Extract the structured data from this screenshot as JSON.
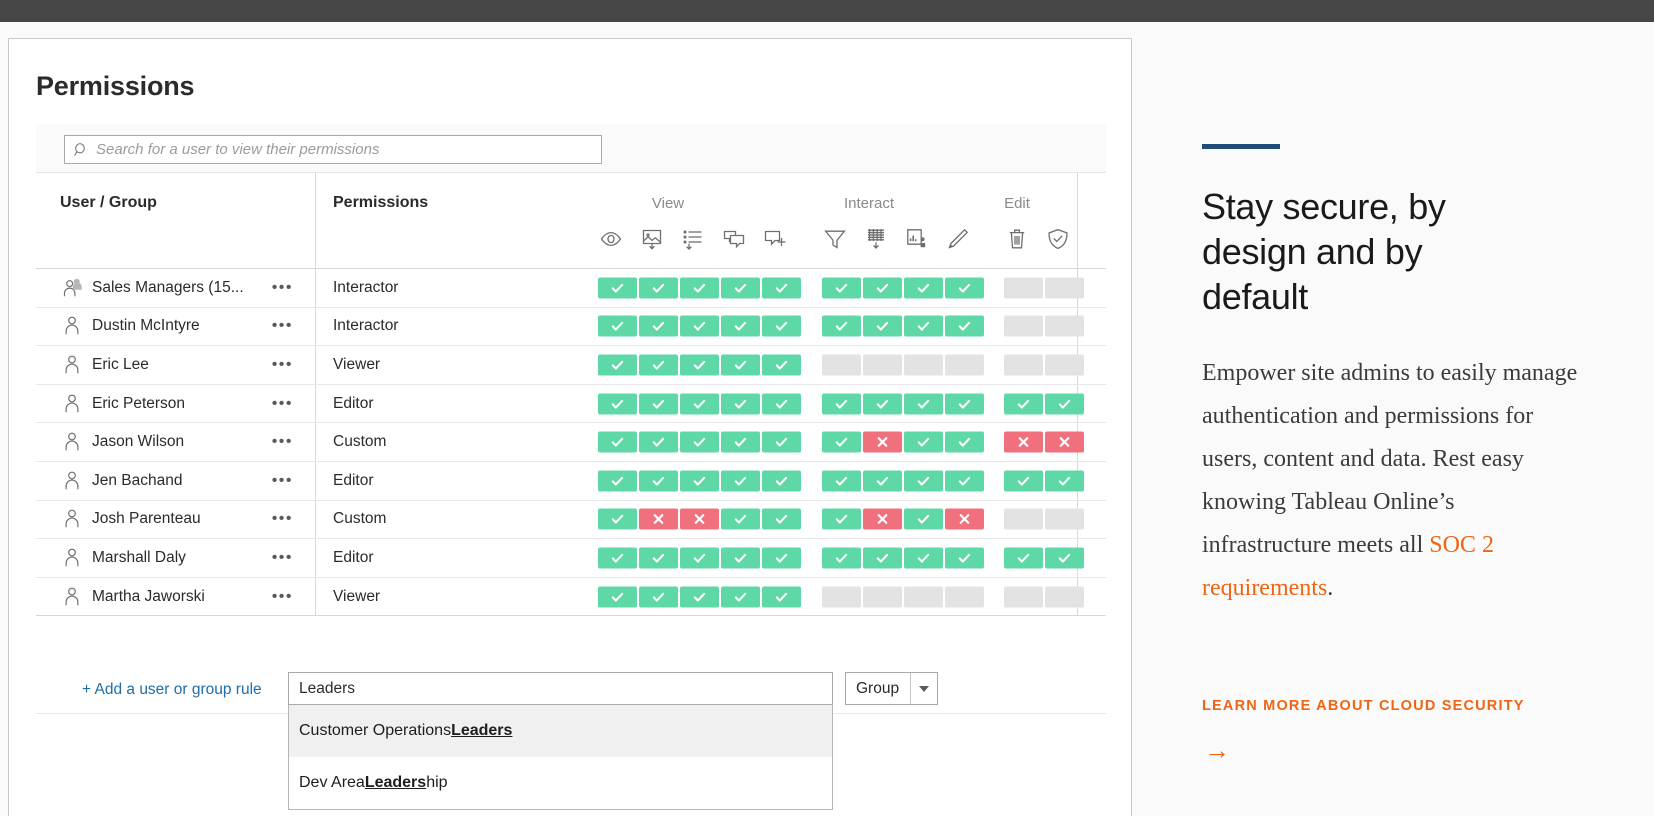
{
  "window": {
    "topbar_color": "#464646"
  },
  "app": {
    "title": "Permissions",
    "search": {
      "placeholder": "Search for a user to view their permissions",
      "value": "",
      "icon": "search-icon"
    },
    "table": {
      "columns": {
        "user_group": "User / Group",
        "permissions": "Permissions"
      },
      "groups": [
        {
          "label": "View",
          "icons": [
            "eye-icon",
            "image-download-icon",
            "list-download-icon",
            "comment-icon",
            "comment-add-icon"
          ]
        },
        {
          "label": "Interact",
          "icons": [
            "filter-icon",
            "data-download-icon",
            "web-edit-icon",
            "pencil-icon"
          ]
        },
        {
          "label": "Edit",
          "icons": [
            "trash-icon",
            "shield-check-icon"
          ]
        }
      ],
      "rows": [
        {
          "name": "Sales Managers (15...",
          "icon": "group-icon",
          "role": "Interactor",
          "view": [
            "allow",
            "allow",
            "allow",
            "allow",
            "allow"
          ],
          "interact": [
            "allow",
            "allow",
            "allow",
            "allow"
          ],
          "edit": [
            "none",
            "none"
          ]
        },
        {
          "name": "Dustin McIntyre",
          "icon": "user-icon",
          "role": "Interactor",
          "view": [
            "allow",
            "allow",
            "allow",
            "allow",
            "allow"
          ],
          "interact": [
            "allow",
            "allow",
            "allow",
            "allow"
          ],
          "edit": [
            "none",
            "none"
          ]
        },
        {
          "name": "Eric Lee",
          "icon": "user-icon",
          "role": "Viewer",
          "view": [
            "allow",
            "allow",
            "allow",
            "allow",
            "allow"
          ],
          "interact": [
            "none",
            "none",
            "none",
            "none"
          ],
          "edit": [
            "none",
            "none"
          ]
        },
        {
          "name": "Eric Peterson",
          "icon": "user-icon",
          "role": "Editor",
          "view": [
            "allow",
            "allow",
            "allow",
            "allow",
            "allow"
          ],
          "interact": [
            "allow",
            "allow",
            "allow",
            "allow"
          ],
          "edit": [
            "allow",
            "allow"
          ]
        },
        {
          "name": "Jason Wilson",
          "icon": "user-icon",
          "role": "Custom",
          "view": [
            "allow",
            "allow",
            "allow",
            "allow",
            "allow"
          ],
          "interact": [
            "allow",
            "deny",
            "allow",
            "allow"
          ],
          "edit": [
            "deny",
            "deny"
          ]
        },
        {
          "name": "Jen Bachand",
          "icon": "user-icon",
          "role": "Editor",
          "view": [
            "allow",
            "allow",
            "allow",
            "allow",
            "allow"
          ],
          "interact": [
            "allow",
            "allow",
            "allow",
            "allow"
          ],
          "edit": [
            "allow",
            "allow"
          ]
        },
        {
          "name": "Josh Parenteau",
          "icon": "user-icon",
          "role": "Custom",
          "view": [
            "allow",
            "deny",
            "deny",
            "allow",
            "allow"
          ],
          "interact": [
            "allow",
            "deny",
            "allow",
            "deny"
          ],
          "edit": [
            "none",
            "none"
          ]
        },
        {
          "name": "Marshall Daly",
          "icon": "user-icon",
          "role": "Editor",
          "view": [
            "allow",
            "allow",
            "allow",
            "allow",
            "allow"
          ],
          "interact": [
            "allow",
            "allow",
            "allow",
            "allow"
          ],
          "edit": [
            "allow",
            "allow"
          ]
        },
        {
          "name": "Martha Jaworski",
          "icon": "user-icon",
          "role": "Viewer",
          "view": [
            "allow",
            "allow",
            "allow",
            "allow",
            "allow"
          ],
          "interact": [
            "none",
            "none",
            "none",
            "none"
          ],
          "edit": [
            "none",
            "none"
          ]
        }
      ]
    },
    "footer": {
      "add_rule_label": "+ Add a user or group rule",
      "name_input": {
        "value": "Leaders",
        "placeholder": ""
      },
      "type_select": {
        "value": "Group"
      },
      "suggestions": [
        {
          "prefix": "Customer Operations ",
          "match": "Leaders",
          "suffix": "",
          "active": true
        },
        {
          "prefix": "Dev Area ",
          "match": "Leaders",
          "suffix": "hip",
          "active": false
        }
      ]
    }
  },
  "promo": {
    "heading": "Stay secure, by design and by default",
    "paragraph_part1": "Empower site admins to easily manage authentication and permissions for users, content and data. Rest easy knowing Tableau Online’s infrastructure meets all ",
    "paragraph_link": "SOC 2 requirements",
    "paragraph_part2": ".",
    "cta": "LEARN MORE ABOUT CLOUD SECURITY",
    "arrow": "→",
    "accent_color": "#ef6513",
    "rule_color": "#1f4e79"
  }
}
